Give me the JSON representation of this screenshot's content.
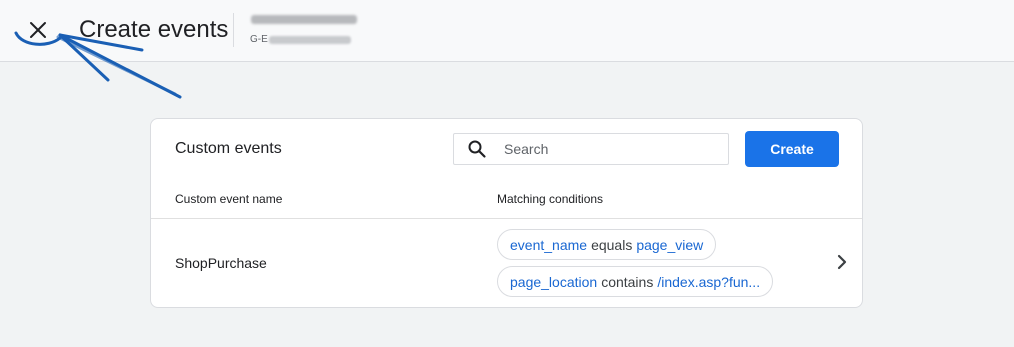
{
  "header": {
    "close_icon": "close-icon",
    "title": "Create events",
    "property_id_prefix": "G-E"
  },
  "card": {
    "title": "Custom events",
    "search": {
      "placeholder": "Search",
      "value": "",
      "icon": "search-icon"
    },
    "create_label": "Create",
    "columns": [
      "Custom event name",
      "Matching conditions"
    ],
    "rows": [
      {
        "name": "ShopPurchase",
        "conditions": [
          {
            "parameter": "event_name",
            "operator": "equals",
            "value": "page_view"
          },
          {
            "parameter": "page_location",
            "operator": "contains",
            "value": "/index.asp?fun..."
          }
        ],
        "chevron_icon": "chevron-right-icon"
      }
    ]
  },
  "colors": {
    "accent": "#1a73e8",
    "link": "#1967d2",
    "annotation": "#1a5fb4"
  }
}
